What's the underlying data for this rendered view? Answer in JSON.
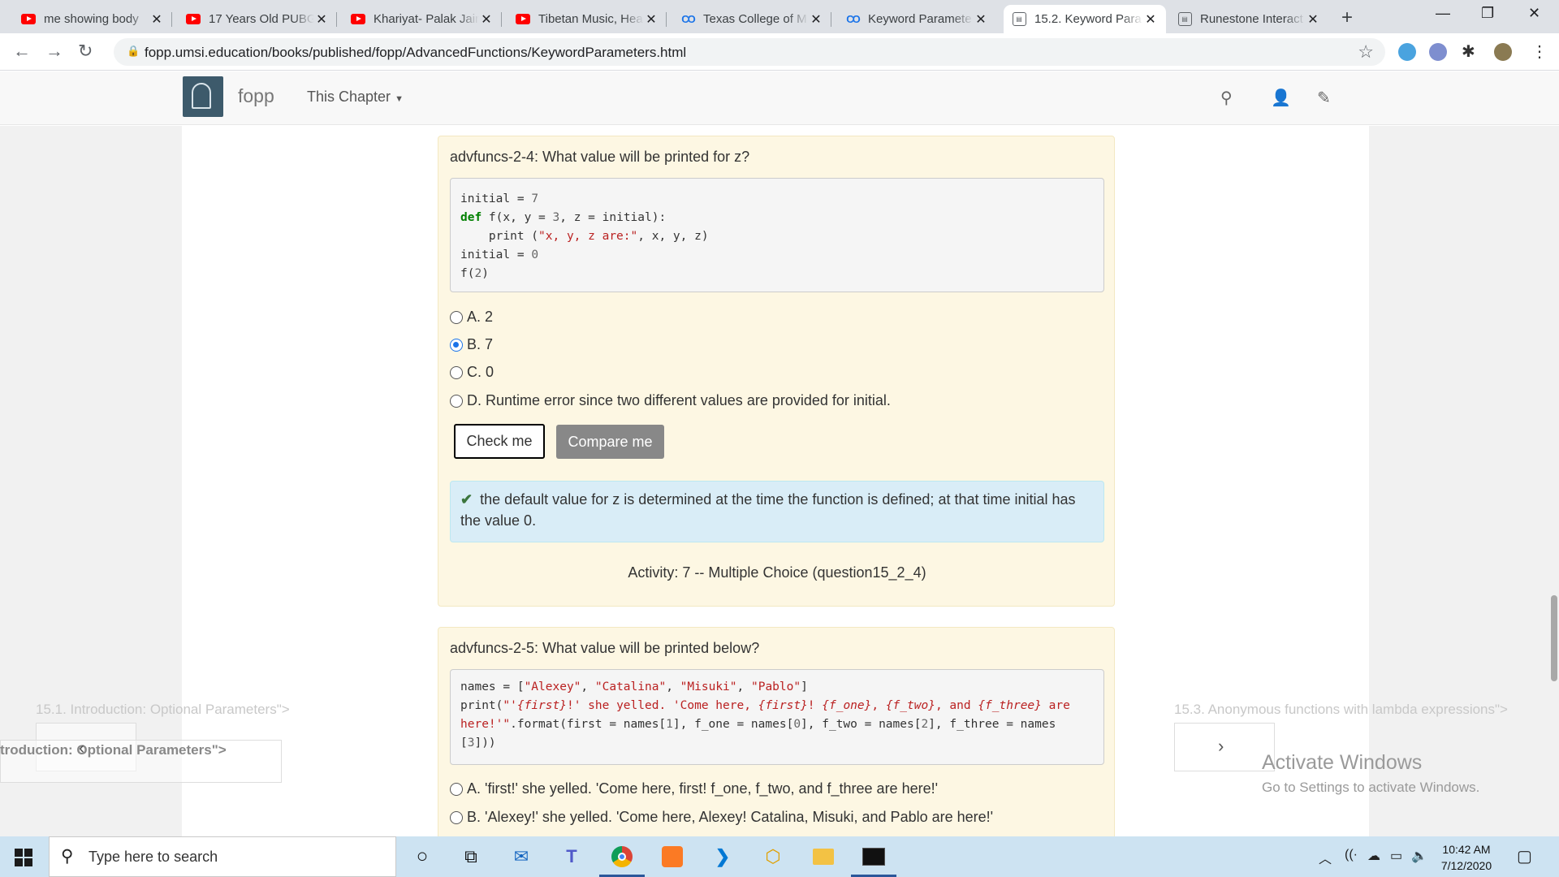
{
  "browser": {
    "tabs": [
      {
        "title": "me showing body",
        "favicon": "youtube-icon"
      },
      {
        "title": "17 Years Old PUBG",
        "favicon": "youtube-icon"
      },
      {
        "title": "Khariyat- Palak Jain",
        "favicon": "youtube-icon"
      },
      {
        "title": "Tibetan Music, Hea",
        "favicon": "youtube-icon"
      },
      {
        "title": "Texas College of M",
        "favicon": "coursera-icon"
      },
      {
        "title": "Keyword Paramete",
        "favicon": "coursera-icon"
      },
      {
        "title": "15.2. Keyword Para",
        "favicon": "runestone-icon"
      },
      {
        "title": "Runestone Interact",
        "favicon": "runestone-icon"
      }
    ],
    "active_tab_index": 6,
    "url": "fopp.umsi.education/books/published/fopp/AdvancedFunctions/KeywordParameters.html"
  },
  "site": {
    "brand": "fopp",
    "chapter_menu": "This Chapter"
  },
  "question1": {
    "title": "advfuncs-2-4: What value will be printed for z?",
    "options": [
      {
        "label": "A. 2",
        "selected": false
      },
      {
        "label": "B. 7",
        "selected": true
      },
      {
        "label": "C. 0",
        "selected": false
      },
      {
        "label": "D. Runtime error since two different values are provided for initial.",
        "selected": false
      }
    ],
    "check_label": "Check me",
    "compare_label": "Compare me",
    "feedback": "the default value for z is determined at the time the function is defined; at that time initial has the value 0.",
    "activity": "Activity: 7 -- Multiple Choice (question15_2_4)"
  },
  "question2": {
    "title": "advfuncs-2-5: What value will be printed below?",
    "options": [
      {
        "label": "A. 'first!' she yelled. 'Come here, first! f_one, f_two, and f_three are here!'",
        "selected": false
      },
      {
        "label": "B. 'Alexey!' she yelled. 'Come here, Alexey! Catalina, Misuki, and Pablo are here!'",
        "selected": false
      }
    ]
  },
  "pager": {
    "prev_ghost": "15.1. Introduction: Optional Parameters\">",
    "prev_label": "troduction: Optional Parameters\">",
    "next_ghost": "15.3. Anonymous functions with lambda expressions\">"
  },
  "watermark": {
    "line1": "Activate Windows",
    "line2": "Go to Settings to activate Windows."
  },
  "taskbar": {
    "search_placeholder": "Type here to search",
    "time": "10:42 AM",
    "date": "7/12/2020"
  }
}
